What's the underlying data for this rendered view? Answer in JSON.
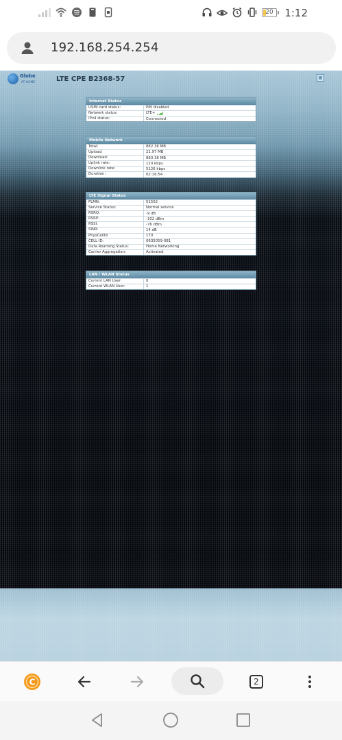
{
  "status_bar": {
    "battery_level": "20",
    "time": "1:12"
  },
  "browser": {
    "url": "192.168.254.254",
    "tab_count": "2"
  },
  "site": {
    "logo_name": "Globe",
    "logo_sub": "AT HOME",
    "device_title": "LTE CPE B2368-57"
  },
  "internet_status": {
    "title": "Internet Status",
    "rows": [
      {
        "label": "USIM card status:",
        "value": "PIN disabled"
      },
      {
        "label": "Network status:",
        "value": "LTE+"
      },
      {
        "label": "IPv4 status:",
        "value": "Connected"
      }
    ]
  },
  "mobile_network": {
    "title": "Mobile Network",
    "rows": [
      {
        "label": "Total:",
        "value": "882.36 MB"
      },
      {
        "label": "Upload:",
        "value": "21.97 MB"
      },
      {
        "label": "Download:",
        "value": "860.38 MB"
      },
      {
        "label": "Uplink rate:",
        "value": "120 kbps"
      },
      {
        "label": "Downlink rate:",
        "value": "5126 kbps"
      },
      {
        "label": "Duration:",
        "value": "02:16:54"
      }
    ]
  },
  "lte_signal": {
    "title": "LTE Signal Status",
    "rows": [
      {
        "label": "PLMN:",
        "value": "51502"
      },
      {
        "label": "Service Status:",
        "value": "Normal service"
      },
      {
        "label": "RSRQ:",
        "value": "-9 dB"
      },
      {
        "label": "RSRP:",
        "value": "-102 dBm"
      },
      {
        "label": "RSSI:",
        "value": "-76 dBm"
      },
      {
        "label": "SINR:",
        "value": "14 dB"
      },
      {
        "label": "PhysCellId:",
        "value": "170"
      },
      {
        "label": "CELL ID:",
        "value": "0635059-081"
      },
      {
        "label": "Data Roaming Status:",
        "value": "Home Networking"
      },
      {
        "label": "Carrier Aggregation:",
        "value": "Activated"
      }
    ]
  },
  "lan_wlan": {
    "title": "LAN / WLAN Status",
    "rows": [
      {
        "label": "Current LAN User:",
        "value": "0"
      },
      {
        "label": "Current WLAN User:",
        "value": "1"
      }
    ]
  },
  "icons": {
    "accent_color": "#f59a1b",
    "lte_bars_color": "#3fae3a"
  }
}
